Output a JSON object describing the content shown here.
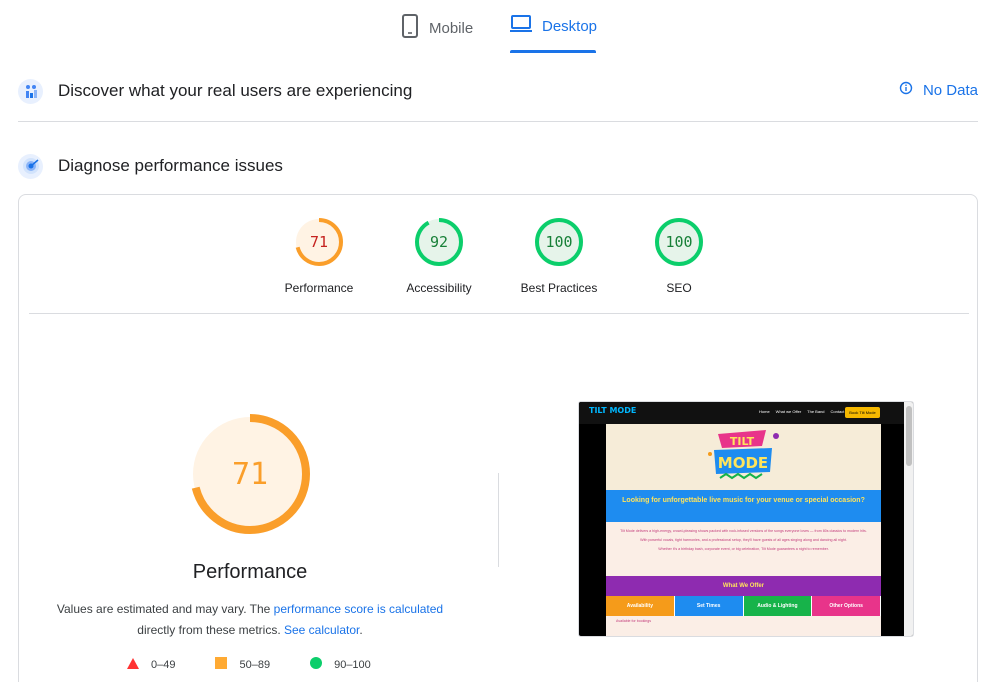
{
  "tabs": {
    "mobile": "Mobile",
    "desktop": "Desktop"
  },
  "field_data": {
    "title": "Discover what your real users are experiencing",
    "status": "No Data"
  },
  "lab_data": {
    "title": "Diagnose performance issues"
  },
  "categories": [
    {
      "name": "Performance",
      "score": "71",
      "value": 71,
      "color": "#fa9e2a",
      "text_color": "#c5221f",
      "bg": "#fff3e4"
    },
    {
      "name": "Accessibility",
      "score": "92",
      "value": 92,
      "color": "#0cce6b",
      "text_color": "#188038",
      "bg": "#e6f4ea"
    },
    {
      "name": "Best Practices",
      "score": "100",
      "value": 100,
      "color": "#0cce6b",
      "text_color": "#188038",
      "bg": "#e6f4ea"
    },
    {
      "name": "SEO",
      "score": "100",
      "value": 100,
      "color": "#0cce6b",
      "text_color": "#188038",
      "bg": "#e6f4ea"
    }
  ],
  "performance": {
    "score": "71",
    "value": 71,
    "label": "Performance",
    "note_prefix": "Values are estimated and may vary. The ",
    "note_link1": "performance score is calculated",
    "note_middle": " directly from these metrics. ",
    "note_link2": "See calculator",
    "note_suffix": "."
  },
  "legend": [
    {
      "range": "0–49",
      "shape": "triangle",
      "color": "#ff3333"
    },
    {
      "range": "50–89",
      "shape": "square",
      "color": "#ffaa33"
    },
    {
      "range": "90–100",
      "shape": "circle",
      "color": "#0cce6b"
    }
  ],
  "screenshot": {
    "logo": "TILT MODE",
    "nav_links": [
      "Home",
      "What we Offer",
      "The Band",
      "Contact"
    ],
    "nav_button": "Book Tilt Mode",
    "headline": "Looking for unforgettable live music for your venue or special occasion?",
    "p1": "Tilt Mode delivers a high-energy, crowd-pleasing shows packed with rock-infused versions of the songs everyone loves — from 80s classics to modern hits.",
    "p2": "With powerful vocals, tight harmonies, and a professional setup, they'll have guests of all ages singing along and dancing all night.",
    "p3": "Whether it's a birthday bash, corporate event, or big celebration, Tilt Mode guarantees a night to remember.",
    "offer_title": "What We Offer",
    "columns": [
      {
        "label": "Availability",
        "color": "#f59b1a"
      },
      {
        "label": "Set Times",
        "color": "#1e8cf0"
      },
      {
        "label": "Audio & Lighting",
        "color": "#17b34a"
      },
      {
        "label": "Other Options",
        "color": "#e8348a"
      }
    ],
    "sub_text": "Available for bookings"
  }
}
